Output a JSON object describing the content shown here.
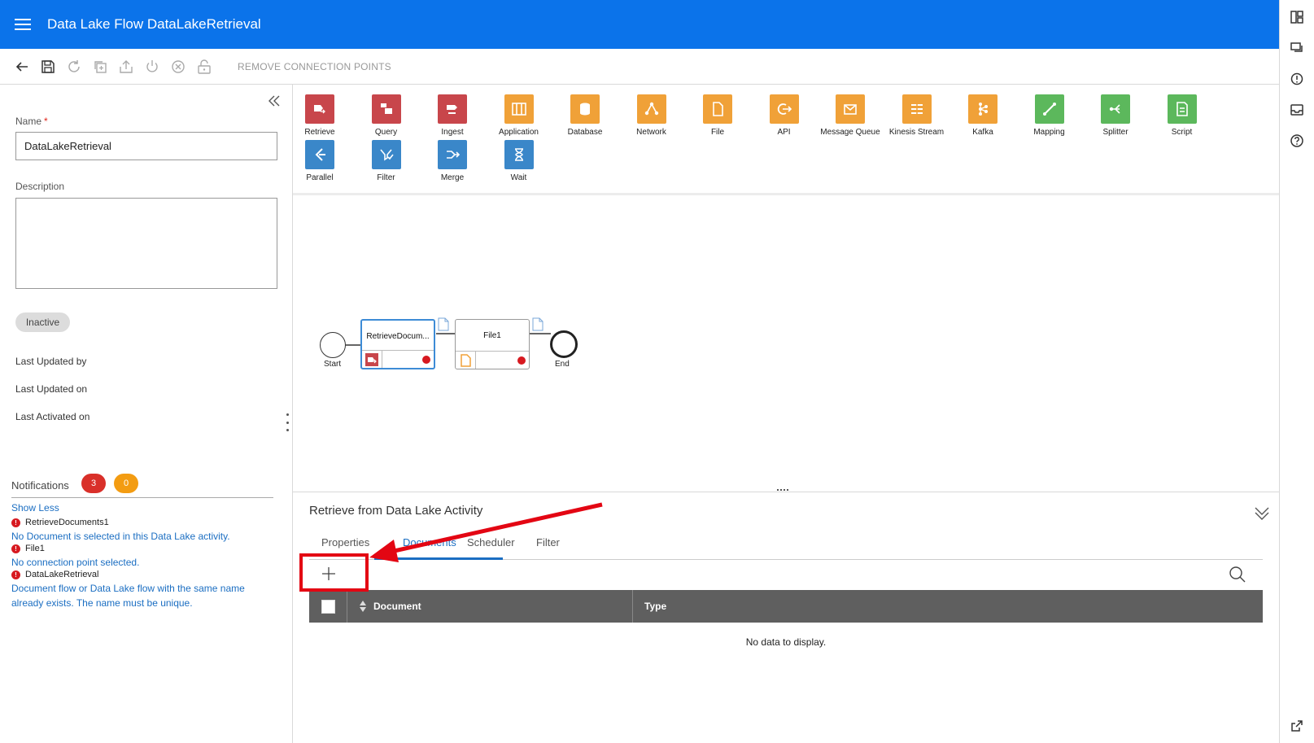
{
  "header": {
    "title": "Data Lake Flow DataLakeRetrieval"
  },
  "toolbar": {
    "remove_label": "REMOVE CONNECTION POINTS"
  },
  "form": {
    "name_label": "Name",
    "required_mark": "*",
    "name_value": "DataLakeRetrieval",
    "description_label": "Description",
    "description_value": "",
    "status": "Inactive",
    "last_updated_by": "Last Updated by",
    "last_updated_on": "Last Updated on",
    "last_activated_on": "Last Activated on"
  },
  "notifications": {
    "title": "Notifications",
    "error_count": "3",
    "warning_count": "0",
    "show_less": "Show Less",
    "items": [
      {
        "source": "RetrieveDocuments1",
        "message": "No Document is selected in this Data Lake activity."
      },
      {
        "source": "File1",
        "message": "No connection point selected."
      },
      {
        "source": "DataLakeRetrieval",
        "message": "Document flow or Data Lake flow with the same name already exists. The name must be unique."
      }
    ]
  },
  "palette": [
    {
      "label": "Retrieve",
      "color": "#c8464b",
      "icon": "retrieve-icon"
    },
    {
      "label": "Query",
      "color": "#c8464b",
      "icon": "query-icon"
    },
    {
      "label": "Ingest",
      "color": "#c8464b",
      "icon": "ingest-icon"
    },
    {
      "label": "Application",
      "color": "#f0a138",
      "icon": "application-icon"
    },
    {
      "label": "Database",
      "color": "#f0a138",
      "icon": "database-icon"
    },
    {
      "label": "Network",
      "color": "#f0a138",
      "icon": "network-icon"
    },
    {
      "label": "File",
      "color": "#f0a138",
      "icon": "file-icon"
    },
    {
      "label": "API",
      "color": "#f0a138",
      "icon": "api-icon"
    },
    {
      "label": "Message Queue",
      "color": "#f0a138",
      "icon": "message-queue-icon"
    },
    {
      "label": "Kinesis Stream",
      "color": "#f0a138",
      "icon": "kinesis-stream-icon"
    },
    {
      "label": "Kafka",
      "color": "#f0a138",
      "icon": "kafka-icon"
    },
    {
      "label": "Mapping",
      "color": "#5cb85c",
      "icon": "mapping-icon"
    },
    {
      "label": "Splitter",
      "color": "#5cb85c",
      "icon": "splitter-icon"
    },
    {
      "label": "Script",
      "color": "#5cb85c",
      "icon": "script-icon"
    },
    {
      "label": "Parallel",
      "color": "#3a87c9",
      "icon": "parallel-icon"
    },
    {
      "label": "Filter",
      "color": "#3a87c9",
      "icon": "filter-icon"
    },
    {
      "label": "Merge",
      "color": "#3a87c9",
      "icon": "merge-icon"
    },
    {
      "label": "Wait",
      "color": "#3a87c9",
      "icon": "wait-icon"
    }
  ],
  "flow": {
    "start_label": "Start",
    "end_label": "End",
    "activities": [
      {
        "name": "RetrieveDocum...",
        "selected": true
      },
      {
        "name": "File1",
        "selected": false
      }
    ]
  },
  "details": {
    "title": "Retrieve from Data Lake Activity",
    "tabs": [
      "Properties",
      "Documents",
      "Scheduler",
      "Filter"
    ],
    "active_tab": "Documents",
    "columns": [
      "Document",
      "Type"
    ],
    "empty_message": "No data to display."
  },
  "colors": {
    "header_blue": "#0b73ea",
    "link_blue": "#1b6ec2",
    "error_red": "#d71920",
    "warning_orange": "#f39c12",
    "annotation_red": "#e30613"
  }
}
